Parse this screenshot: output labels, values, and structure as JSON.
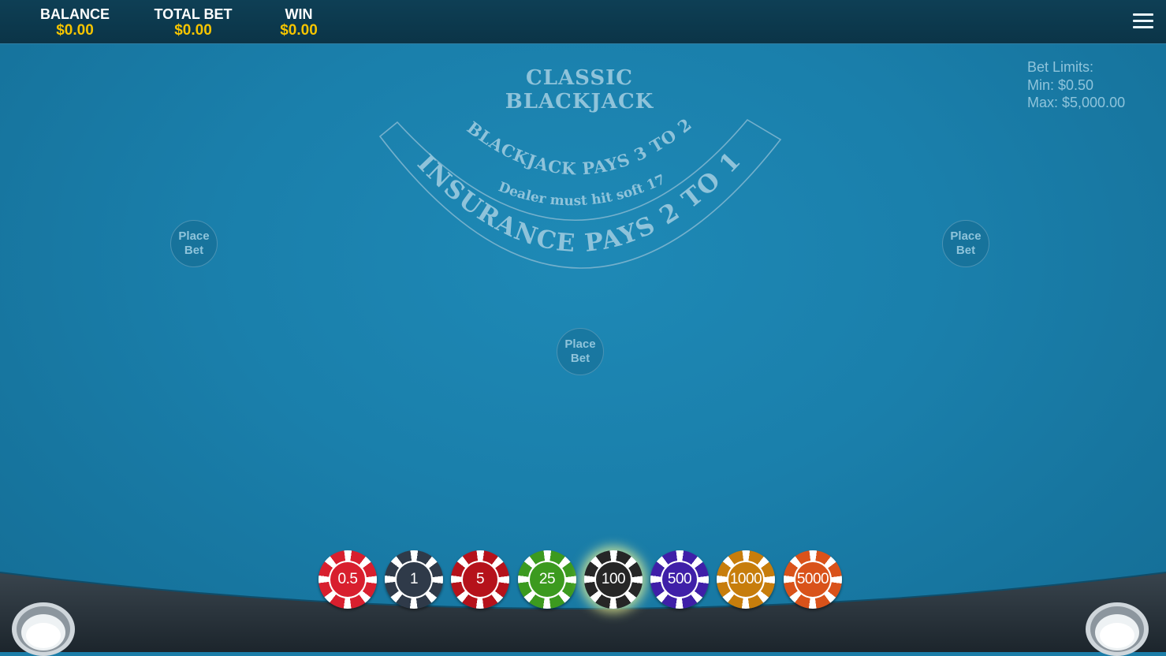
{
  "header": {
    "balance_label": "BALANCE",
    "balance_value": "$0.00",
    "total_bet_label": "TOTAL BET",
    "total_bet_value": "$0.00",
    "win_label": "WIN",
    "win_value": "$0.00"
  },
  "table": {
    "title_line1": "CLASSIC",
    "title_line2": "BLACKJACK",
    "payout_blackjack": "BLACKJACK PAYS 3 TO 2",
    "dealer_rule": "Dealer must hit soft 17",
    "payout_insurance": "INSURANCE PAYS 2 TO 1"
  },
  "bet_limits": {
    "label": "Bet Limits:",
    "min": "Min: $0.50",
    "max": "Max: $5,000.00"
  },
  "seats": [
    {
      "label_line1": "Place",
      "label_line2": "Bet"
    },
    {
      "label_line1": "Place",
      "label_line2": "Bet"
    },
    {
      "label_line1": "Place",
      "label_line2": "Bet"
    }
  ],
  "chips": [
    {
      "value": "0.5",
      "color": "#d81f2e",
      "selected": false
    },
    {
      "value": "1",
      "color": "#2f3a49",
      "selected": false
    },
    {
      "value": "5",
      "color": "#b5121b",
      "selected": false
    },
    {
      "value": "25",
      "color": "#3c9a1f",
      "selected": false
    },
    {
      "value": "100",
      "color": "#262626",
      "selected": true
    },
    {
      "value": "500",
      "color": "#3f1fa8",
      "selected": false
    },
    {
      "value": "1000",
      "color": "#c77d0c",
      "selected": false
    },
    {
      "value": "5000",
      "color": "#d9521a",
      "selected": false
    }
  ],
  "colors": {
    "felt": "#1b7da8",
    "header_bg": "#0e3f55",
    "accent_gold": "#f5c400",
    "table_text": "#8fc3da"
  }
}
